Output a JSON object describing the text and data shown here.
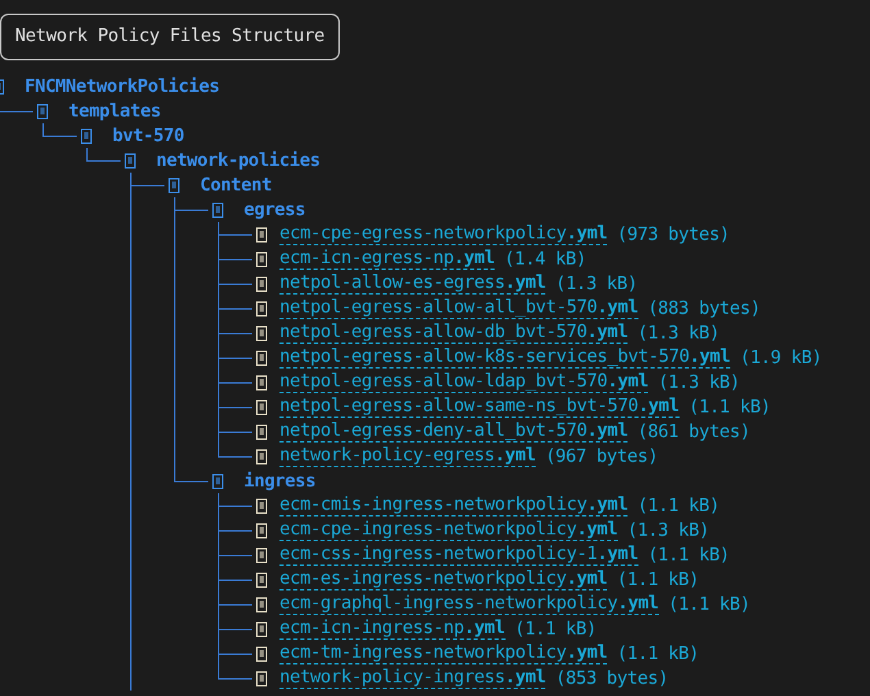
{
  "title": "Network Policy Files Structure",
  "tree": {
    "kind": "folder",
    "name": "FNCMNetworkPolicies",
    "children": [
      {
        "kind": "folder",
        "name": "templates",
        "children": [
          {
            "kind": "folder",
            "name": "bvt-570",
            "children": [
              {
                "kind": "folder",
                "name": "network-policies",
                "children": [
                  {
                    "kind": "folder",
                    "name": "Content",
                    "more_siblings_below": true,
                    "children": [
                      {
                        "kind": "folder",
                        "name": "egress",
                        "children": [
                          {
                            "kind": "file",
                            "name": "ecm-cpe-egress-networkpolicy**.yml**",
                            "size": "(973 bytes)"
                          },
                          {
                            "kind": "file",
                            "name": "ecm-icn-egress-np**.yml**",
                            "size": "(1.4 kB)"
                          },
                          {
                            "kind": "file",
                            "name": "netpol-allow-es-egress**.yml**",
                            "size": "(1.3 kB)"
                          },
                          {
                            "kind": "file",
                            "name": "netpol-egress-allow-all_bvt-570**.yml**",
                            "size": "(883 bytes)"
                          },
                          {
                            "kind": "file",
                            "name": "netpol-egress-allow-db_bvt-570**.yml**",
                            "size": "(1.3 kB)"
                          },
                          {
                            "kind": "file",
                            "name": "netpol-egress-allow-k8s-services_bvt-570**.yml**",
                            "size": "(1.9 kB)"
                          },
                          {
                            "kind": "file",
                            "name": "netpol-egress-allow-ldap_bvt-570**.yml**",
                            "size": "(1.3 kB)"
                          },
                          {
                            "kind": "file",
                            "name": "netpol-egress-allow-same-ns_bvt-570**.yml**",
                            "size": "(1.1 kB)"
                          },
                          {
                            "kind": "file",
                            "name": "netpol-egress-deny-all_bvt-570**.yml**",
                            "size": "(861 bytes)"
                          },
                          {
                            "kind": "file",
                            "name": "network-policy-egress**.yml**",
                            "size": "(967 bytes)"
                          }
                        ]
                      },
                      {
                        "kind": "folder",
                        "name": "ingress",
                        "children": [
                          {
                            "kind": "file",
                            "name": "ecm-cmis-ingress-networkpolicy**.yml**",
                            "size": "(1.1 kB)"
                          },
                          {
                            "kind": "file",
                            "name": "ecm-cpe-ingress-networkpolicy**.yml**",
                            "size": "(1.3 kB)"
                          },
                          {
                            "kind": "file",
                            "name": "ecm-css-ingress-networkpolicy-1**.yml**",
                            "size": "(1.1 kB)"
                          },
                          {
                            "kind": "file",
                            "name": "ecm-es-ingress-networkpolicy**.yml**",
                            "size": "(1.1 kB)"
                          },
                          {
                            "kind": "file",
                            "name": "ecm-graphql-ingress-networkpolicy**.yml**",
                            "size": "(1.1 kB)"
                          },
                          {
                            "kind": "file",
                            "name": "ecm-icn-ingress-np**.yml**",
                            "size": "(1.1 kB)"
                          },
                          {
                            "kind": "file",
                            "name": "ecm-tm-ingress-networkpolicy**.yml**",
                            "size": "(1.1 kB)"
                          },
                          {
                            "kind": "file",
                            "name": "network-policy-ingress**.yml**",
                            "size": "(853 bytes)"
                          }
                        ]
                      }
                    ]
                  }
                ]
              }
            ]
          }
        ]
      }
    ]
  }
}
